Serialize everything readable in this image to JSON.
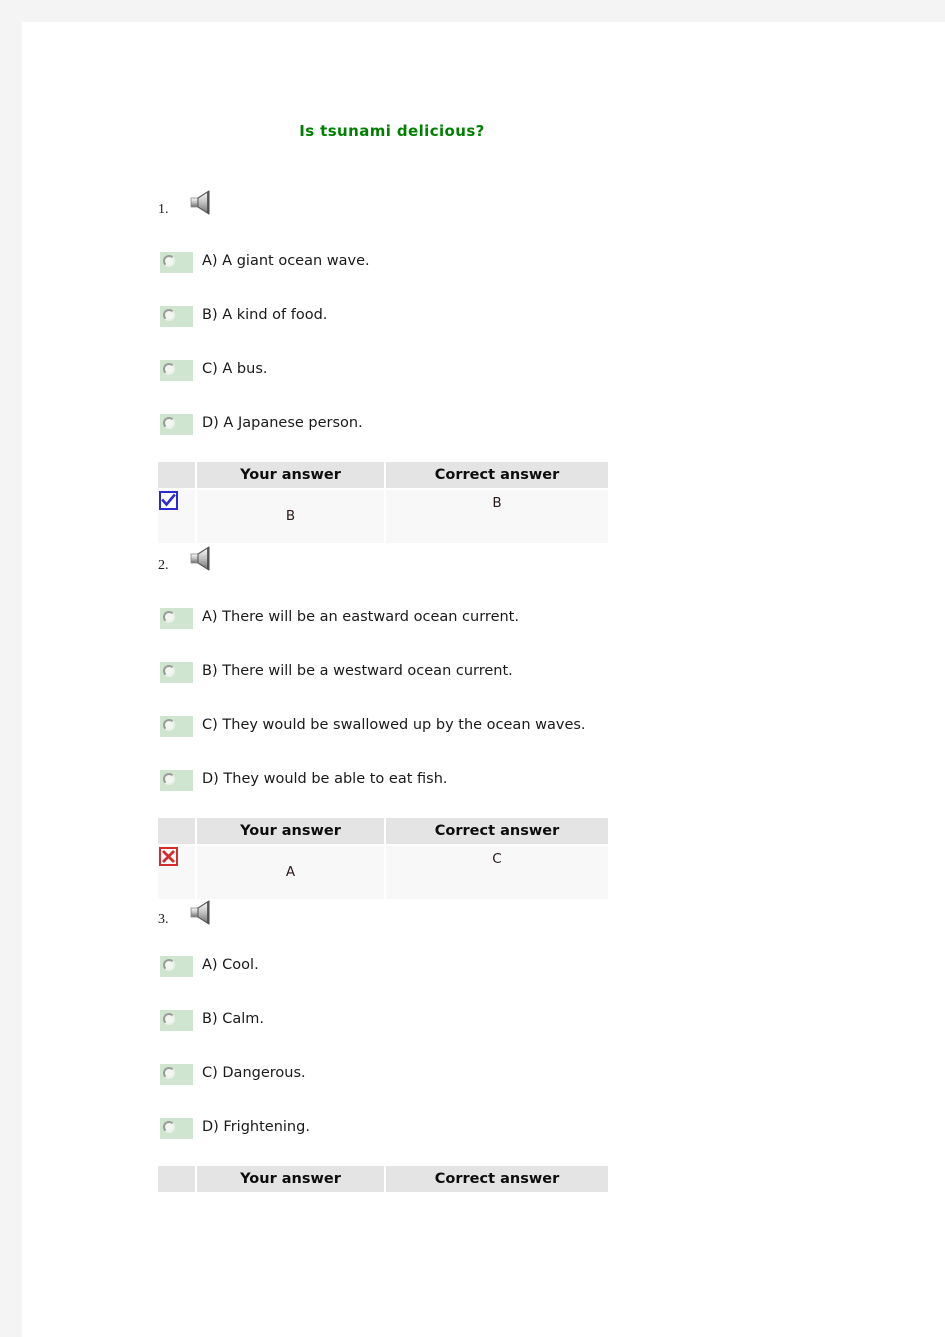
{
  "page": {
    "title": "Is tsunami delicious?",
    "title_color": "#008000",
    "background_color": "#f4f4f4",
    "sheet_color": "#ffffff"
  },
  "table_headers": {
    "mark_column": "",
    "your_answer": "Your answer",
    "correct_answer": "Correct answer"
  },
  "icons": {
    "speaker": "speaker-icon",
    "radio": "radio-button-icon",
    "correct": "checkmark-icon",
    "wrong": "cross-icon"
  },
  "questions": [
    {
      "number": "1.",
      "options": [
        {
          "label": "A) A giant ocean wave."
        },
        {
          "label": "B) A kind of food."
        },
        {
          "label": "C) A bus."
        },
        {
          "label": "D) A Japanese person."
        }
      ],
      "result": {
        "status": "correct",
        "your_answer": "B",
        "correct_answer": "B"
      }
    },
    {
      "number": "2.",
      "options": [
        {
          "label": "A) There will be an eastward ocean current."
        },
        {
          "label": "B) There will be a westward ocean current."
        },
        {
          "label": "C) They would be swallowed up by the ocean waves."
        },
        {
          "label": "D) They would be able to eat fish."
        }
      ],
      "result": {
        "status": "wrong",
        "your_answer": "A",
        "correct_answer": "C"
      }
    },
    {
      "number": "3.",
      "options": [
        {
          "label": "A) Cool."
        },
        {
          "label": "B) Calm."
        },
        {
          "label": "C) Dangerous."
        },
        {
          "label": "D) Frightening."
        }
      ],
      "result": {
        "status": "none",
        "your_answer": "",
        "correct_answer": ""
      }
    }
  ]
}
